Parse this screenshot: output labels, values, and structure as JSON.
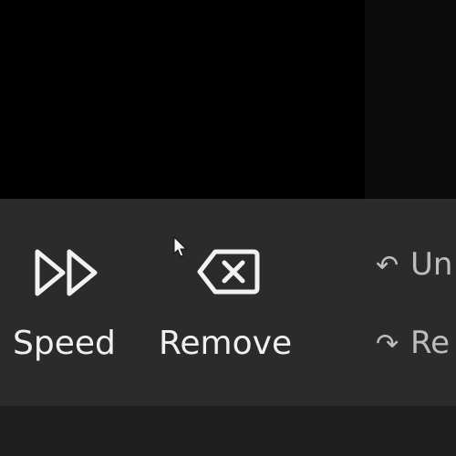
{
  "toolbar": {
    "speed": {
      "label": "Speed",
      "icon": "fast-forward-icon"
    },
    "remove": {
      "label": "Remove",
      "icon": "backspace-icon"
    },
    "undo": {
      "label": "Un",
      "icon": "undo-icon"
    },
    "redo": {
      "label": "Re",
      "icon": "redo-icon"
    }
  },
  "colors": {
    "toolbar_bg": "#2b2b2b",
    "viewport_bg": "#000000",
    "text": "#f0f0f0",
    "muted_text": "#bdbdbd"
  }
}
